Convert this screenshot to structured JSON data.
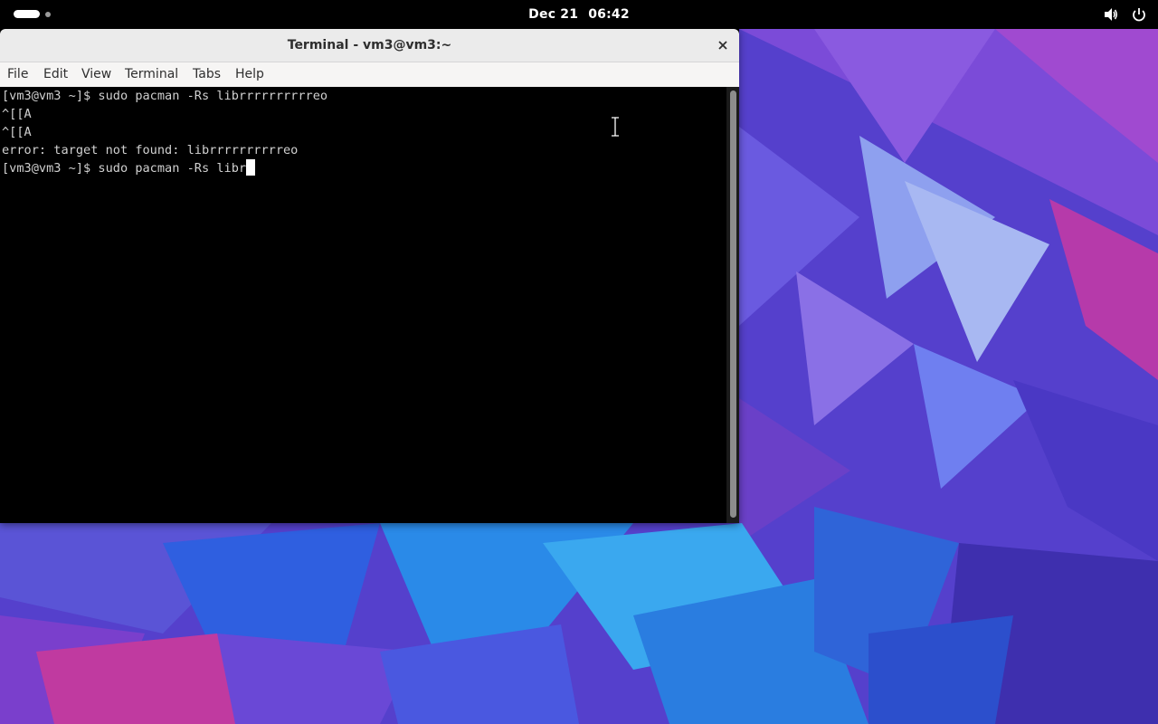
{
  "topbar": {
    "date": "Dec 21",
    "time": "06:42",
    "icons": [
      "activities-indicator",
      "volume-icon",
      "power-icon"
    ]
  },
  "window": {
    "title": "Terminal - vm3@vm3:~",
    "close_icon": "close-icon"
  },
  "menu": {
    "file": "File",
    "edit": "Edit",
    "view": "View",
    "terminal": "Terminal",
    "tabs": "Tabs",
    "help": "Help"
  },
  "terminal": {
    "lines": [
      "[vm3@vm3 ~]$ sudo pacman -Rs librrrrrrrrrreo",
      "^[[A",
      "^[[A",
      "error: target not found: librrrrrrrrrreo"
    ],
    "current_line": "[vm3@vm3 ~]$ sudo pacman -Rs libr"
  },
  "colors": {
    "topbar_bg": "#000000",
    "terminal_bg": "#000000",
    "terminal_fg": "#d0d0d0",
    "titlebar_bg": "#ebebeb",
    "wallpaper_primary": "#5b3fd0",
    "wallpaper_accent": "#2a8ae8"
  }
}
